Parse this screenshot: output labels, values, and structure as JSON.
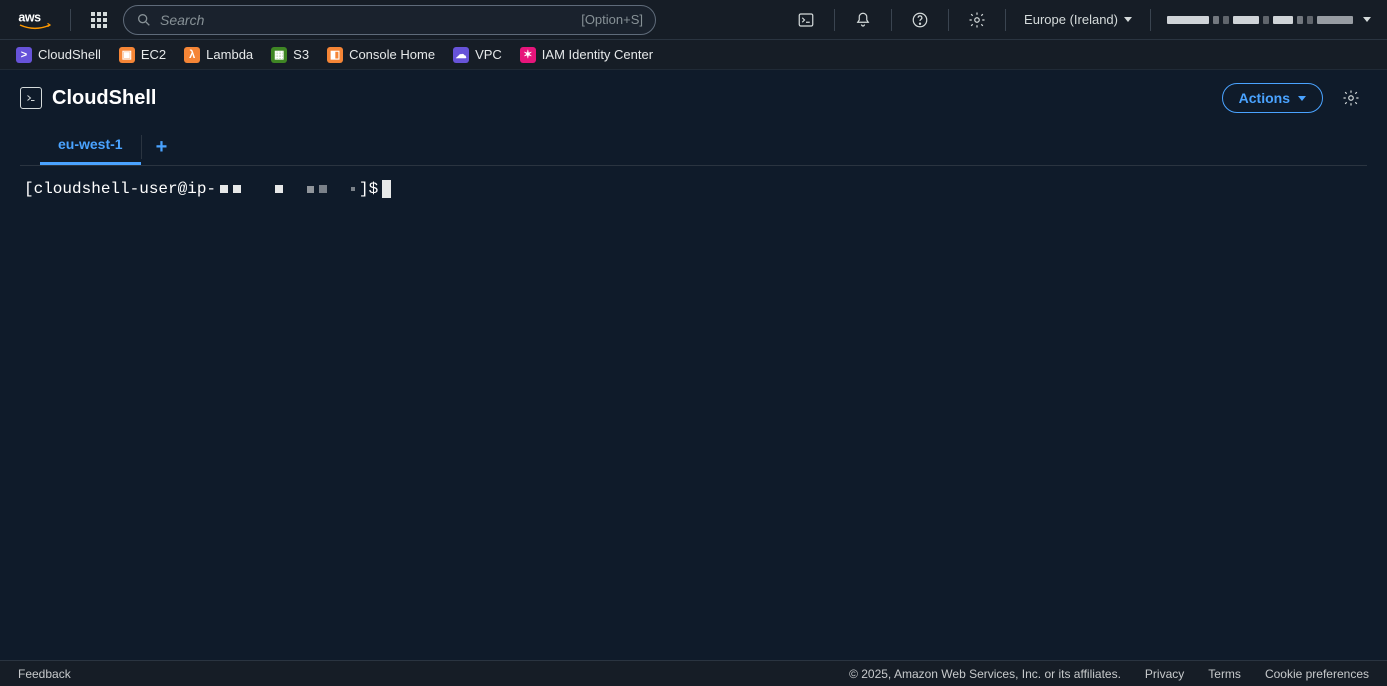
{
  "topnav": {
    "search_placeholder": "Search",
    "search_shortcut": "[Option+S]",
    "region_label": "Europe (Ireland)"
  },
  "favorites": [
    {
      "label": "CloudShell",
      "icon": "cs"
    },
    {
      "label": "EC2",
      "icon": "ec2"
    },
    {
      "label": "Lambda",
      "icon": "lambda"
    },
    {
      "label": "S3",
      "icon": "s3"
    },
    {
      "label": "Console Home",
      "icon": "ch"
    },
    {
      "label": "VPC",
      "icon": "vpc"
    },
    {
      "label": "IAM Identity Center",
      "icon": "iam"
    }
  ],
  "page": {
    "title": "CloudShell",
    "actions_label": "Actions"
  },
  "tabs": {
    "active_label": "eu-west-1"
  },
  "terminal": {
    "prompt_prefix": "[cloudshell-user@ip-",
    "prompt_suffix": "]$"
  },
  "footer": {
    "feedback": "Feedback",
    "copyright": "© 2025, Amazon Web Services, Inc. or its affiliates.",
    "privacy": "Privacy",
    "terms": "Terms",
    "cookies": "Cookie preferences"
  }
}
